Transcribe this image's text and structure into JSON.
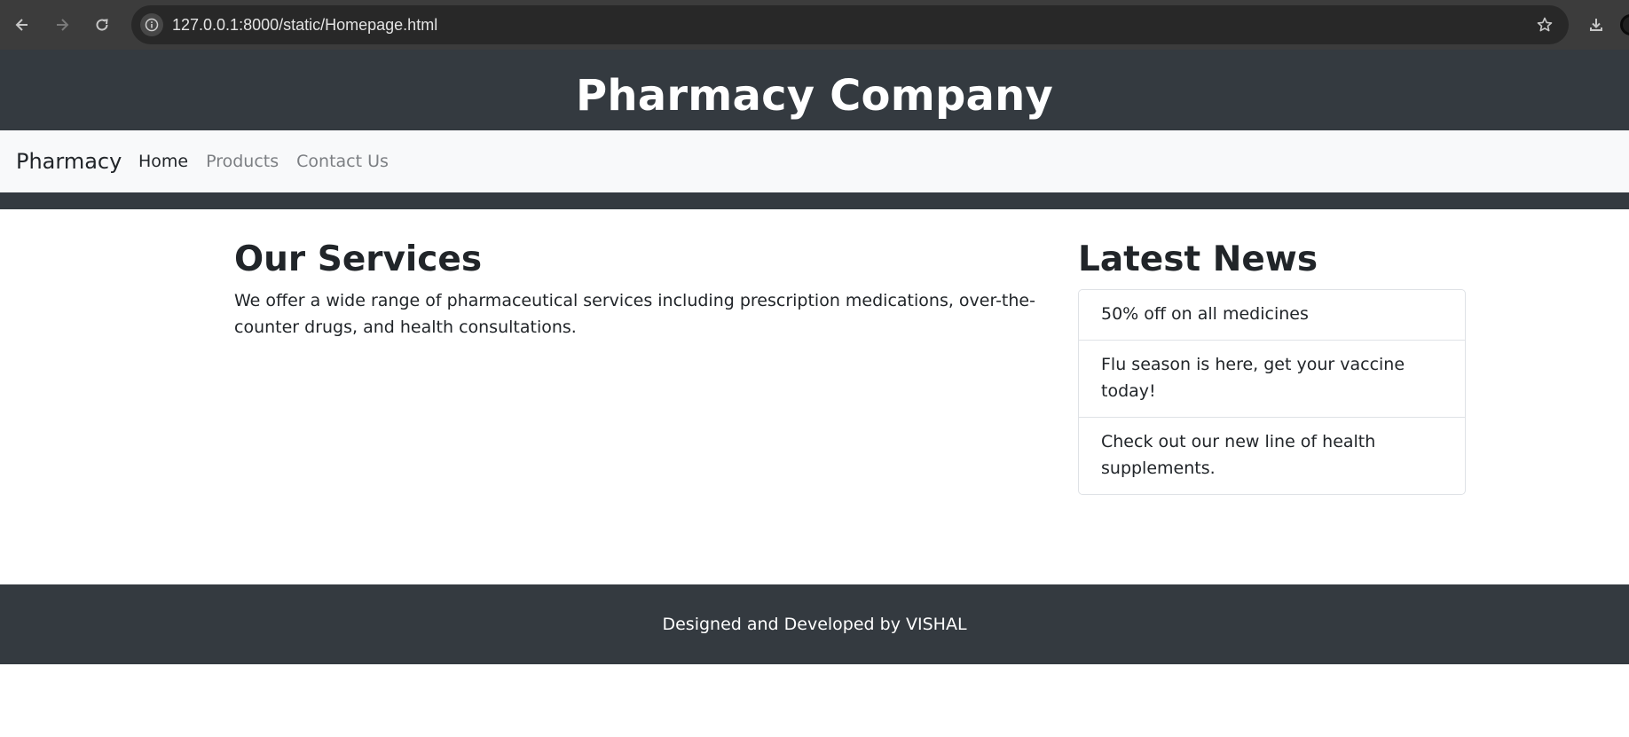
{
  "browser": {
    "url": "127.0.0.1:8000/static/Homepage.html",
    "icons": [
      "back-arrow-icon",
      "forward-arrow-icon",
      "reload-icon",
      "info-icon",
      "star-icon",
      "download-icon"
    ]
  },
  "header": {
    "title": "Pharmacy Company"
  },
  "navbar": {
    "brand": "Pharmacy",
    "links": [
      {
        "label": "Home",
        "active": true
      },
      {
        "label": "Products",
        "active": false
      },
      {
        "label": "Contact Us",
        "active": false
      }
    ]
  },
  "services": {
    "heading": "Our Services",
    "text": "We offer a wide range of pharmaceutical services including prescription medications, over-the-counter drugs, and health consultations."
  },
  "news": {
    "heading": "Latest News",
    "items": [
      "50% off on all medicines",
      "Flu season is here, get your vaccine today!",
      "Check out our new line of health supplements."
    ]
  },
  "footer": {
    "text": "Designed and Developed by VISHAL"
  },
  "colors": {
    "dark": "#343a40",
    "navbar_bg": "#f8f9fa",
    "browser_bar": "#3c3c3c",
    "muted_link": "#7c7f83"
  }
}
